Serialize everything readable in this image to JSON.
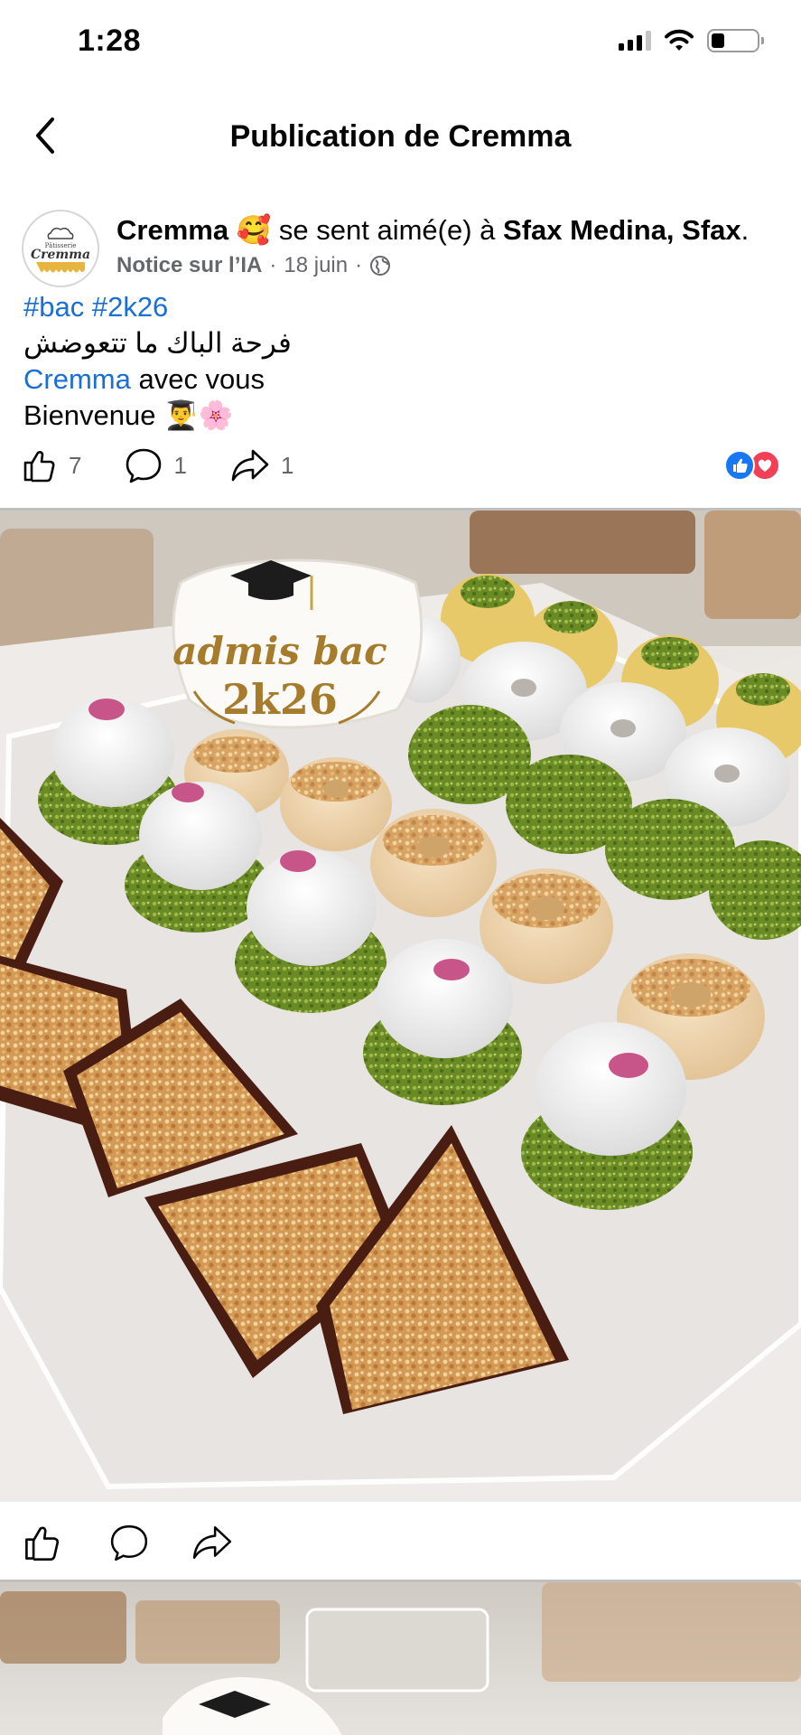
{
  "status_bar": {
    "time": "1:28"
  },
  "header": {
    "title": "Publication de Cremma"
  },
  "post": {
    "author": "Cremma",
    "feeling_emoji": "🥰",
    "feeling_text": "se sent aimé(e) à",
    "location": "Sfax Medina, Sfax",
    "location_suffix": ".",
    "ai_notice": "Notice sur l’IA",
    "separator": "·",
    "date": "18 juin",
    "avatar_text_top": "Pâtisserie",
    "avatar_text_main": "Cremma",
    "hashtags": "#bac #2k26",
    "line_arabic": "فرحة الباك ما تتعوضش",
    "mention": "Cremma",
    "line_mention_rest": " avec vous",
    "line_welcome": "Bienvenue",
    "welcome_emojis": "👨‍🎓🌸",
    "counts": {
      "likes": "7",
      "comments": "1",
      "shares": "1"
    }
  },
  "photo": {
    "sign_line1": "admis bac",
    "sign_line2": "2k26"
  },
  "colors": {
    "link": "#1a6ed8",
    "like": "#1877f2",
    "love": "#f33e58",
    "meta": "#65676b"
  }
}
